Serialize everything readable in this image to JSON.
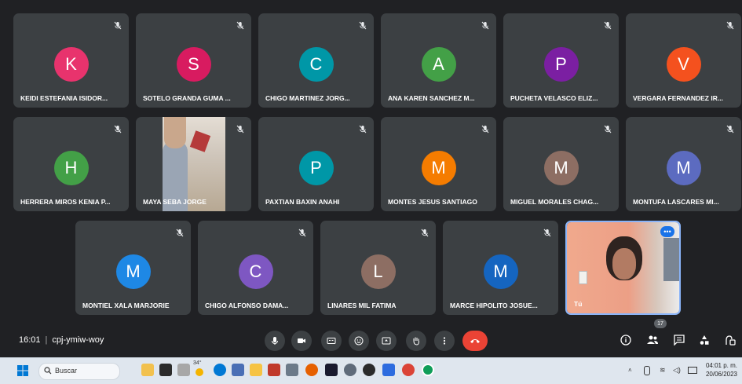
{
  "participants": [
    {
      "initial": "K",
      "name": "KEIDI ESTEFANIA ISIDOR...",
      "color": "#e8336d"
    },
    {
      "initial": "S",
      "name": "SOTELO GRANDA GUMA ...",
      "color": "#d81b60"
    },
    {
      "initial": "C",
      "name": "CHIGO MARTINEZ JORG...",
      "color": "#0097a7"
    },
    {
      "initial": "A",
      "name": "ANA KAREN SANCHEZ M...",
      "color": "#43a047"
    },
    {
      "initial": "P",
      "name": "PUCHETA VELASCO ELIZ...",
      "color": "#7b1fa2"
    },
    {
      "initial": "V",
      "name": "VERGARA FERNANDEZ IR...",
      "color": "#f4511e"
    },
    {
      "initial": "H",
      "name": "HERRERA MIROS KENIA P...",
      "color": "#43a047"
    },
    {
      "initial": "",
      "name": "MAYA SEBA JORGE",
      "color": "",
      "video": true
    },
    {
      "initial": "P",
      "name": "PAXTIAN BAXIN ANAHI",
      "color": "#0097a7"
    },
    {
      "initial": "M",
      "name": "MONTES JESUS SANTIAGO",
      "color": "#f57c00"
    },
    {
      "initial": "M",
      "name": "MIGUEL MORALES CHAG...",
      "color": "#8d6e63"
    },
    {
      "initial": "M",
      "name": "MONTUFA LASCARES MI...",
      "color": "#5c6bc0"
    },
    {
      "initial": "M",
      "name": "MONTIEL XALA MARJORIE",
      "color": "#1e88e5"
    },
    {
      "initial": "C",
      "name": "CHIGO ALFONSO DAMA...",
      "color": "#7e57c2"
    },
    {
      "initial": "L",
      "name": "LINARES MIL FATIMA",
      "color": "#8d6e63"
    },
    {
      "initial": "M",
      "name": "MARCE HIPOLITO JOSUE...",
      "color": "#1565c0"
    },
    {
      "initial": "",
      "name": "Tú",
      "color": "",
      "self": true
    }
  ],
  "meeting": {
    "time": "16:01",
    "code": "cpj-ymiw-woy",
    "people_count": "17"
  },
  "controls": [
    "mic-icon",
    "camera-icon",
    "captions-icon",
    "emoji-icon",
    "present-icon",
    "raise-hand-icon",
    "more-options-icon",
    "end-call-icon"
  ],
  "right_controls": [
    "info-icon",
    "people-icon",
    "chat-icon",
    "activities-icon",
    "host-controls-icon"
  ],
  "taskbar": {
    "search_placeholder": "Buscar",
    "temp": "34°",
    "time": "04:01 p. m.",
    "date": "20/06/2023"
  }
}
